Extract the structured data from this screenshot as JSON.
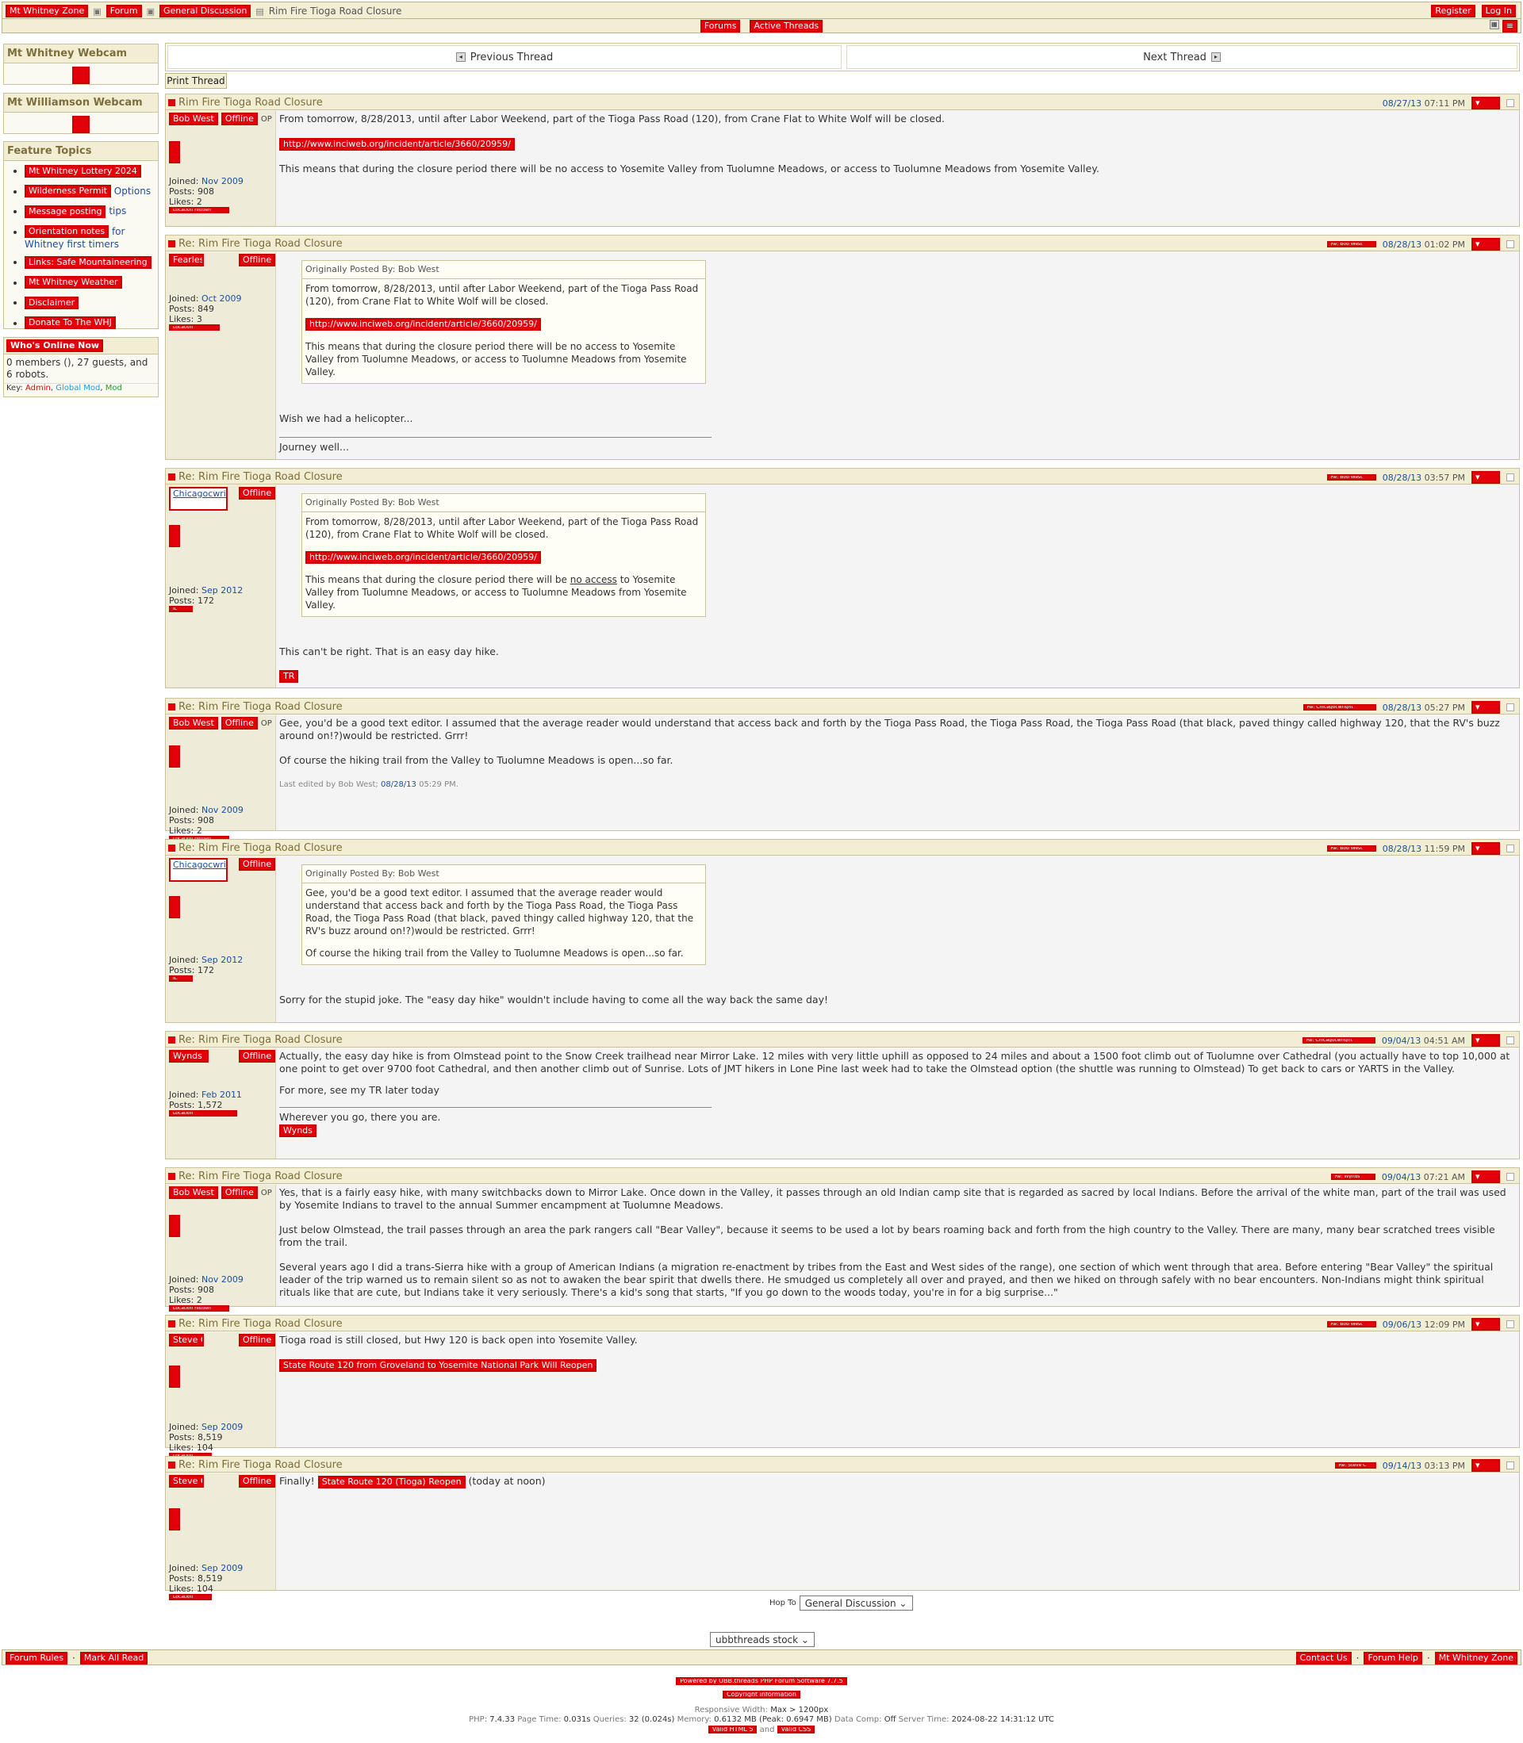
{
  "topbar": {
    "crumb_home": "Mt Whitney Zone",
    "crumb_forum": "Forum",
    "crumb_board": "General Discussion",
    "crumb_current": "Rim Fire Tioga Road Closure",
    "register": "Register",
    "login": "Log In",
    "forums": "Forums",
    "active_threads": "Active Threads"
  },
  "sidebar": {
    "webcam_title": "Mt Whitney Webcam",
    "williamson_title": "Mt Williamson Webcam",
    "feature_title": "Feature Topics",
    "feature_items": [
      {
        "link": "Mt Whitney Lottery 2024",
        "rest": ""
      },
      {
        "link": "Wilderness Permit",
        "rest": "Options"
      },
      {
        "link": "Message posting",
        "rest": "tips"
      },
      {
        "link": "Orientation notes",
        "rest": "for Whitney first timers"
      },
      {
        "link": "Links: Safe Mountaineering",
        "rest": ""
      },
      {
        "link": "Mt Whitney Weather",
        "rest": ""
      },
      {
        "link": "Disclaimer",
        "rest": ""
      },
      {
        "link": "Donate To The WHJ",
        "rest": ""
      }
    ],
    "whos_online_title": "Who's Online Now",
    "online_text": "0 members (), 27 guests, and 6 robots.",
    "key_label": "Key:",
    "key_admin": "Admin",
    "key_global": "Global Mod",
    "key_mod": "Mod"
  },
  "threadnav": {
    "previous": "Previous Thread",
    "next": "Next Thread",
    "print": "Print Thread"
  },
  "posts": [
    {
      "subject": "Rim Fire Tioga Road Closure",
      "date": "08/27/13",
      "time": "07:11 PM",
      "user": "Bob West",
      "status": "Offline",
      "op": "OP",
      "joined_label": "Joined:",
      "joined": "Nov 2009",
      "posts_label": "Posts:",
      "posts": "908",
      "likes_label": "Likes:",
      "likes": "2",
      "location": "Location hidden",
      "p1": "From tomorrow, 8/28/2013, until after Labor Weekend, part of the Tioga Pass Road (120), from Crane Flat to White Wolf will be closed.",
      "link": "http://www.inciweb.org/incident/article/3660/20959/",
      "p2": "This means that during the closure period there will be no access to Yosemite Valley from Tuolumne Meadows, or access to Tuolumne Meadows from Yosemite Valley."
    },
    {
      "subject": "Re: Rim Fire Tioga Road Closure",
      "post_ref": "Re: Bob West",
      "date": "08/28/13",
      "time": "01:02 PM",
      "user": "Fearless",
      "status": "Offline",
      "joined_label": "Joined:",
      "joined": "Oct 2009",
      "posts_label": "Posts:",
      "posts": "849",
      "likes_label": "Likes:",
      "likes": "3",
      "location": "Location",
      "quote_by": "Originally Posted By: Bob West",
      "q1": "From tomorrow, 8/28/2013, until after Labor Weekend, part of the Tioga Pass Road (120), from Crane Flat to White Wolf will be closed.",
      "qlink": "http://www.inciweb.org/incident/article/3660/20959/",
      "q2": "This means that during the closure period there will be no access to Yosemite Valley from Tuolumne Meadows, or access to Tuolumne Meadows from Yosemite Valley.",
      "p1": "Wish we had a helicopter...",
      "sig": "Journey well..."
    },
    {
      "subject": "Re: Rim Fire Tioga Road Closure",
      "post_ref": "Re: Bob West",
      "date": "08/28/13",
      "time": "03:57 PM",
      "user": "Chicagocwright",
      "status": "Offline",
      "joined_label": "Joined:",
      "joined": "Sep 2012",
      "posts_label": "Posts:",
      "posts": "172",
      "location": "IL",
      "quote_by": "Originally Posted By: Bob West",
      "q1": "From tomorrow, 8/28/2013, until after Labor Weekend, part of the Tioga Pass Road (120), from Crane Flat to White Wolf will be closed.",
      "qlink": "http://www.inciweb.org/incident/article/3660/20959/",
      "q2a": "This means that during the closure period there will be",
      "q2u": "no access",
      "q2b": "to Yosemite Valley from Tuolumne Meadows, or access to Tuolumne Meadows from Yosemite Valley.",
      "p1": "This can't be right. That is an easy day hike.",
      "tag": "TR"
    },
    {
      "subject": "Re: Rim Fire Tioga Road Closure",
      "post_ref": "Re: Chicagocwright",
      "date": "08/28/13",
      "time": "05:27 PM",
      "user": "Bob West",
      "status": "Offline",
      "op": "OP",
      "joined_label": "Joined:",
      "joined": "Nov 2009",
      "posts_label": "Posts:",
      "posts": "908",
      "likes_label": "Likes:",
      "likes": "2",
      "location": "Location hidden",
      "p1": "Gee, you'd be a good text editor. I assumed that the average reader would understand that access back and forth by the Tioga Pass Road, the Tioga Pass Road, the Tioga Pass Road (that black, paved thingy called highway 120, that the RV's buzz around on!?)would be restricted. Grrr!",
      "p2": "Of course the hiking trail from the Valley to Tuolumne Meadows is open...so far.",
      "edit_prefix": "Last edited by Bob West;",
      "edit_date": "08/28/13",
      "edit_time": "05:29 PM."
    },
    {
      "subject": "Re: Rim Fire Tioga Road Closure",
      "post_ref": "Re: Bob West",
      "date": "08/28/13",
      "time": "11:59 PM",
      "user": "Chicagocwright",
      "status": "Offline",
      "joined_label": "Joined:",
      "joined": "Sep 2012",
      "posts_label": "Posts:",
      "posts": "172",
      "location": "IL",
      "quote_by": "Originally Posted By: Bob West",
      "q1": "Gee, you'd be a good text editor. I assumed that the average reader would understand that access back and forth by the Tioga Pass Road, the Tioga Pass Road, the Tioga Pass Road (that black, paved thingy called highway 120, that the RV's buzz around on!?)would be restricted. Grrr!",
      "q2": "Of course the hiking trail from the Valley to Tuolumne Meadows is open...so far.",
      "p1": "Sorry for the stupid joke. The \"easy day hike\" wouldn't include having to come all the way back the same day!"
    },
    {
      "subject": "Re: Rim Fire Tioga Road Closure",
      "post_ref": "Re: Chicagocwright",
      "date": "09/04/13",
      "time": "04:51 AM",
      "user": "Wynds",
      "status": "Offline",
      "joined_label": "Joined:",
      "joined": "Feb 2011",
      "posts_label": "Posts:",
      "posts": "1,572",
      "location": "Location",
      "p1": "Actually, the easy day hike is from Olmstead point to the Snow Creek trailhead near Mirror Lake. 12 miles with very little uphill as opposed to 24 miles and about a 1500 foot climb out of Tuolumne over Cathedral (you actually have to top 10,000 at one point to get over 9700 foot Cathedral, and then another climb out of Sunrise. Lots of JMT hikers in Lone Pine last week had to take the Olmstead option (the shuttle was running to Olmstead) To get back to cars or YARTS in the Valley.",
      "p2": "For more, see my TR later today",
      "sig": "Wherever you go, there you are.",
      "sig_tag": "Wynds"
    },
    {
      "subject": "Re: Rim Fire Tioga Road Closure",
      "post_ref": "Re: Wynds",
      "date": "09/04/13",
      "time": "07:21 AM",
      "user": "Bob West",
      "status": "Offline",
      "op": "OP",
      "joined_label": "Joined:",
      "joined": "Nov 2009",
      "posts_label": "Posts:",
      "posts": "908",
      "likes_label": "Likes:",
      "likes": "2",
      "location": "Location hidden",
      "p1": "Yes, that is a fairly easy hike, with many switchbacks down to Mirror Lake. Once down in the Valley, it passes through an old Indian camp site that is regarded as sacred by local Indians. Before the arrival of the white man, part of the trail was used by Yosemite Indians to travel to the annual Summer encampment at Tuolumne Meadows.",
      "p2": "Just below Olmstead, the trail passes through an area the park rangers call \"Bear Valley\", because it seems to be used a lot by bears roaming back and forth from the high country to the Valley. There are many, many bear scratched trees visible from the trail.",
      "p3": "Several years ago I did a trans-Sierra hike with a group of American Indians (a migration re-enactment by tribes from the East and West sides of the range), one section of which went through that area. Before entering \"Bear Valley\" the spiritual leader of the trip warned us to remain silent so as not to awaken the bear spirit that dwells there. He smudged us completely all over and prayed, and then we hiked on through safely with no bear encounters. Non-Indians might think spiritual rituals like that are cute, but Indians take it very seriously. There's a kid's song that starts, \"If you go down to the woods today, you're in for a big surprise...\""
    },
    {
      "subject": "Re: Rim Fire Tioga Road Closure",
      "post_ref": "Re: Bob West",
      "date": "09/06/13",
      "time": "12:09 PM",
      "user": "Steve C",
      "status": "Offline",
      "joined_label": "Joined:",
      "joined": "Sep 2009",
      "posts_label": "Posts:",
      "posts": "8,519",
      "likes_label": "Likes:",
      "likes": "104",
      "location": "Location",
      "p1": "Tioga road is still closed, but Hwy 120 is back open into Yosemite Valley.",
      "link": "State Route 120 from Groveland to Yosemite National Park Will Reopen"
    },
    {
      "subject": "Re: Rim Fire Tioga Road Closure",
      "post_ref": "Re: Steve C",
      "date": "09/14/13",
      "time": "03:13 PM",
      "user": "Steve C",
      "status": "Offline",
      "joined_label": "Joined:",
      "joined": "Sep 2009",
      "posts_label": "Posts:",
      "posts": "8,519",
      "likes_label": "Likes:",
      "likes": "104",
      "location": "Location",
      "p_pre": "Finally!",
      "link": "State Route 120 (Tioga) Reopen",
      "p_post": "(today at noon)"
    }
  ],
  "bottom": {
    "hop_to_label": "Hop To",
    "hop_to_value": "General Discussion",
    "style_value": "ubbthreads stock",
    "forum_rules": "Forum Rules",
    "mark_all_read": "Mark All Read",
    "contact_us": "Contact Us",
    "forum_help": "Forum Help",
    "site_name": "Mt Whitney Zone",
    "powered_by": "Powered by UBB.threads PHP Forum Software 7.7.5",
    "powered_line2": "Copyright information",
    "resp_label": "Responsive Width:",
    "resp_value": "Max > 1200px",
    "php_label": "PHP:",
    "php_value": "7.4.33",
    "pagetime_label": "Page Time:",
    "pagetime_value": "0.031s",
    "queries_label": "Queries:",
    "queries_value": "32 (0.024s)",
    "memory_label": "Memory:",
    "memory_value": "0.6132 MB (Peak: 0.6947 MB)",
    "datacomp_label": "Data Comp:",
    "datacomp_value": "Off",
    "servertime_label": "Server Time:",
    "servertime_value": "2024-08-22 14:31:12 UTC",
    "valid_html": "Valid HTML 5",
    "and": "and",
    "valid_css": "Valid CSS"
  },
  "colors": {
    "header_bg": "#f2eed4",
    "subject_color": "#7d6e3c",
    "redaction": "#e3000b",
    "link": "#1b4f9c"
  }
}
